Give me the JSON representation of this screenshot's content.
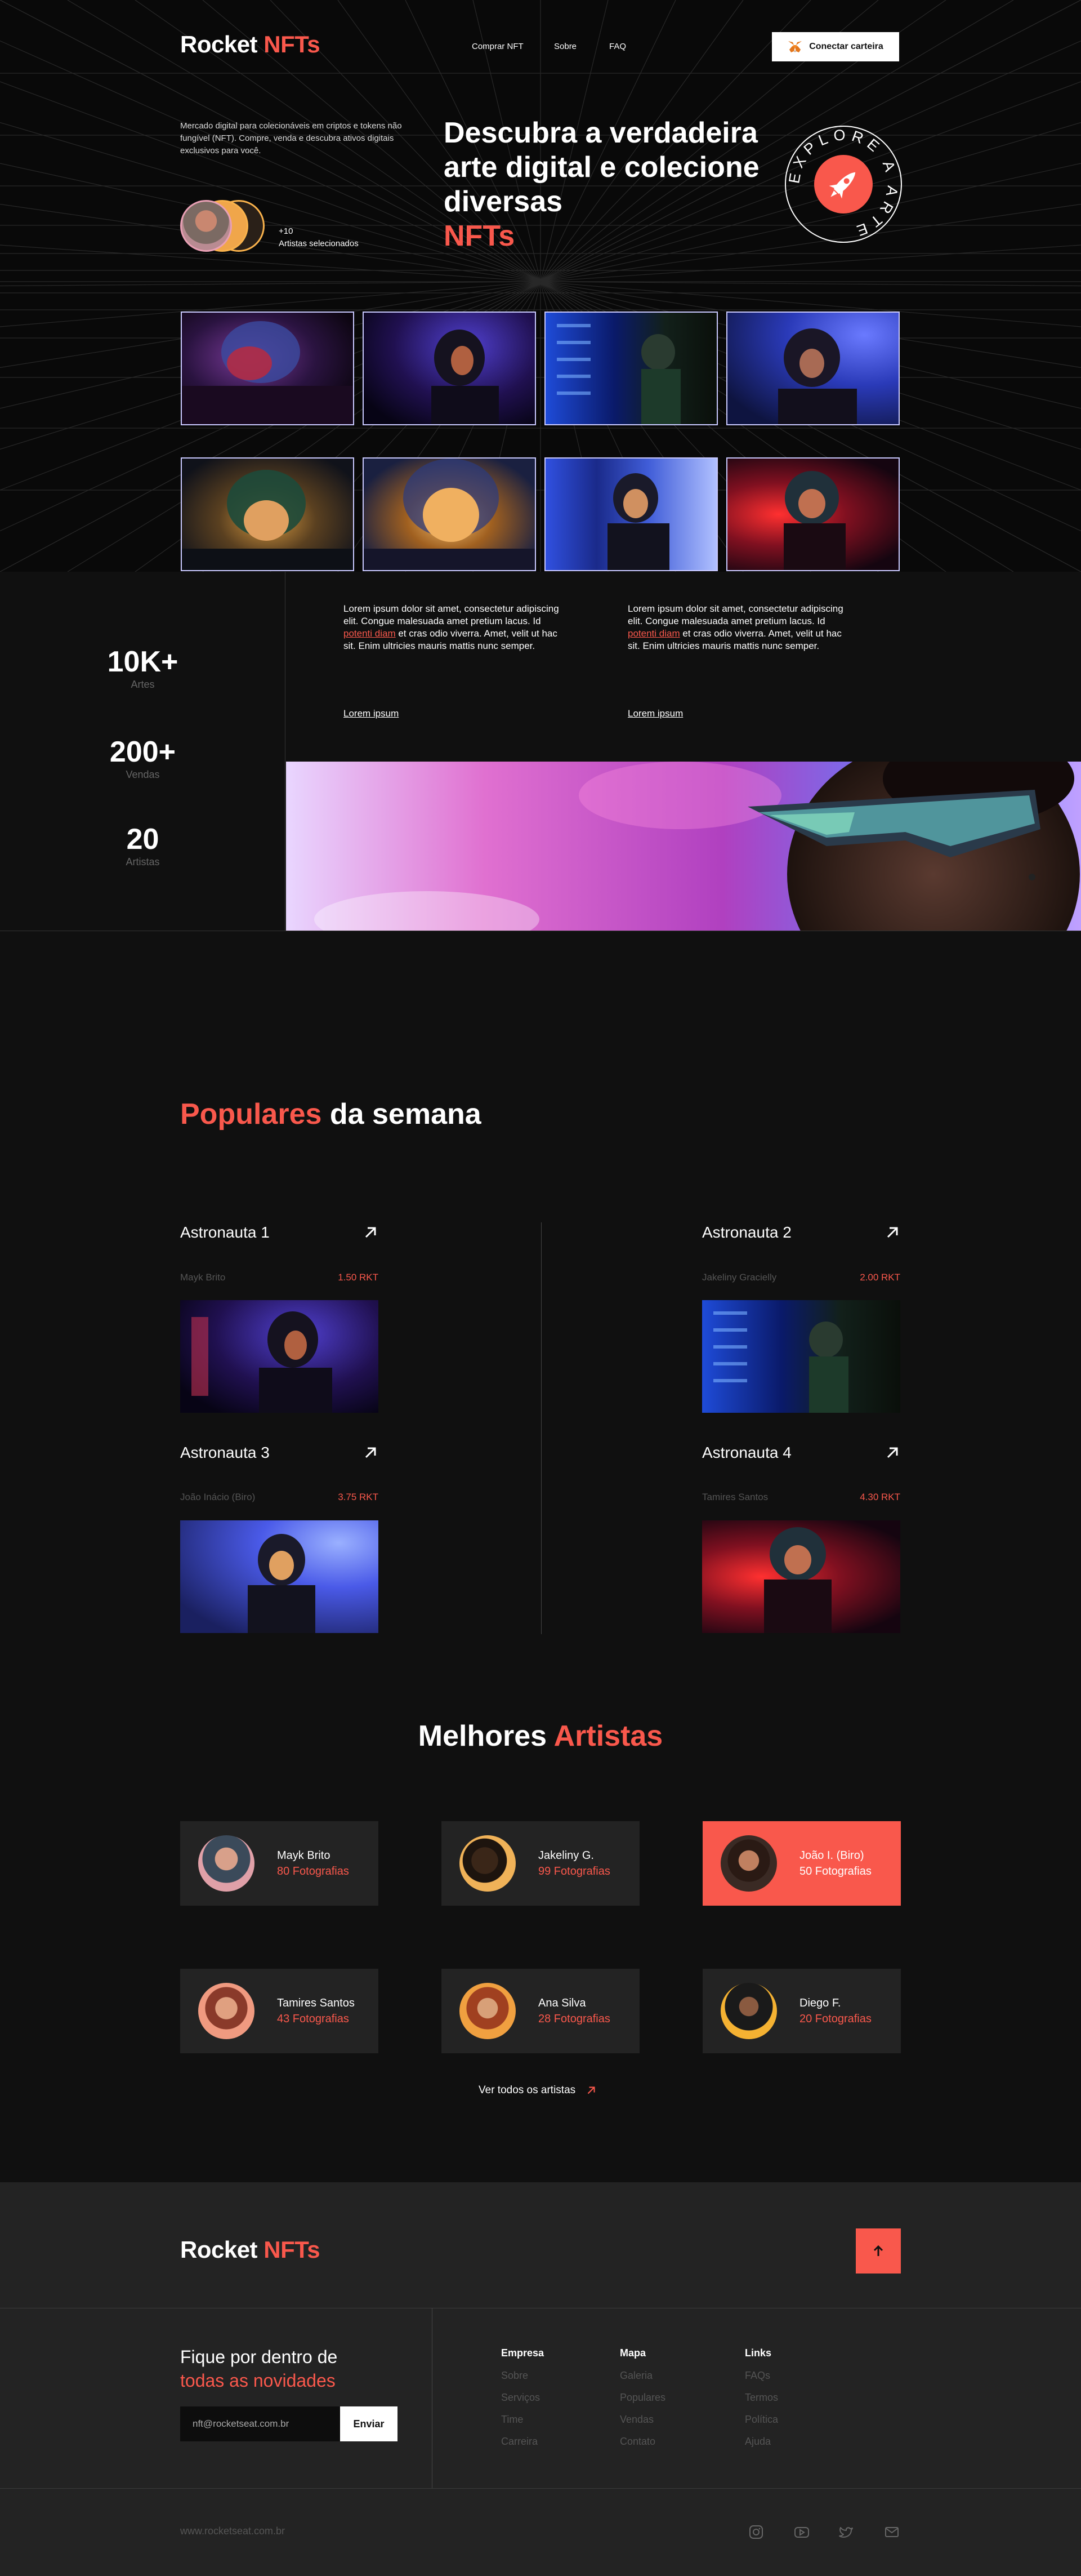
{
  "brand": {
    "name_a": "Rocket",
    "name_b": "NFTs"
  },
  "nav": {
    "items": [
      "Comprar NFT",
      "Sobre",
      "FAQ"
    ],
    "wallet_label": "Conectar carteira"
  },
  "hero": {
    "intro": "Mercado digital para colecionáveis em criptos e tokens não fungível (NFT). Compre, venda e descubra ativos digitais exclusivos para você.",
    "artists_count": "+10",
    "artists_label": "Artistas selecionados",
    "title_main": "Descubra a verdadeira arte digital e colecione diversas",
    "title_accent": "NFTs",
    "badge_text": "EXPLORE A ARTE"
  },
  "stats": [
    {
      "value": "10K+",
      "label": "Artes"
    },
    {
      "value": "200+",
      "label": "Vendas"
    },
    {
      "value": "20",
      "label": "Artistas"
    }
  ],
  "about": [
    {
      "text_a": "Lorem ipsum dolor sit amet, consectetur adipiscing elit. Congue malesuada amet pretium lacus. Id ",
      "highlight": "potenti diam",
      "text_b": " et cras odio viverra. Amet, velit ut hac sit. Enim ultricies mauris mattis nunc semper.",
      "link": "Lorem ipsum"
    },
    {
      "text_a": "Lorem ipsum dolor sit amet, consectetur adipiscing elit. Congue malesuada amet pretium lacus. Id ",
      "highlight": "potenti diam",
      "text_b": " et cras odio viverra. Amet, velit ut hac sit. Enim ultricies mauris mattis nunc semper.",
      "link": "Lorem ipsum"
    }
  ],
  "popular": {
    "title_accent": "Populares",
    "title_rest": "da semana",
    "items": [
      {
        "title": "Astronauta 1",
        "author": "Mayk Brito",
        "price": "1.50 RKT"
      },
      {
        "title": "Astronauta 2",
        "author": "Jakeliny Gracielly",
        "price": "2.00 RKT"
      },
      {
        "title": "Astronauta 3",
        "author": "João Inácio (Biro)",
        "price": "3.75 RKT"
      },
      {
        "title": "Astronauta 4",
        "author": "Tamires Santos",
        "price": "4.30 RKT"
      }
    ]
  },
  "artists": {
    "title_main": "Melhores",
    "title_accent": "Artistas",
    "items": [
      {
        "name": "Mayk Brito",
        "photos": "80 Fotografias"
      },
      {
        "name": "Jakeliny G.",
        "photos": "99 Fotografias"
      },
      {
        "name": "João I. (Biro)",
        "photos": "50 Fotografias"
      },
      {
        "name": "Tamires Santos",
        "photos": "43 Fotografias"
      },
      {
        "name": "Ana Silva",
        "photos": "28 Fotografias"
      },
      {
        "name": "Diego F.",
        "photos": "20 Fotografias"
      }
    ],
    "see_all": "Ver todos os artistas"
  },
  "footer": {
    "news_line1": "Fique por dentro de",
    "news_line2": "todas as novidades",
    "email_value": "nft@rocketseat.com.br",
    "send_label": "Enviar",
    "columns": [
      {
        "title": "Empresa",
        "links": [
          "Sobre",
          "Serviços",
          "Time",
          "Carreira"
        ]
      },
      {
        "title": "Mapa",
        "links": [
          "Galeria",
          "Populares",
          "Vendas",
          "Contato"
        ]
      },
      {
        "title": "Links",
        "links": [
          "FAQs",
          "Termos",
          "Política",
          "Ajuda"
        ]
      }
    ],
    "copyright": "www.rocketseat.com.br",
    "social": [
      "instagram-icon",
      "youtube-icon",
      "twitter-icon",
      "mail-icon"
    ]
  },
  "colors": {
    "accent": "#f9584c",
    "bg": "#101010",
    "panel": "#232323",
    "tile_border": "#c9c9ff"
  }
}
